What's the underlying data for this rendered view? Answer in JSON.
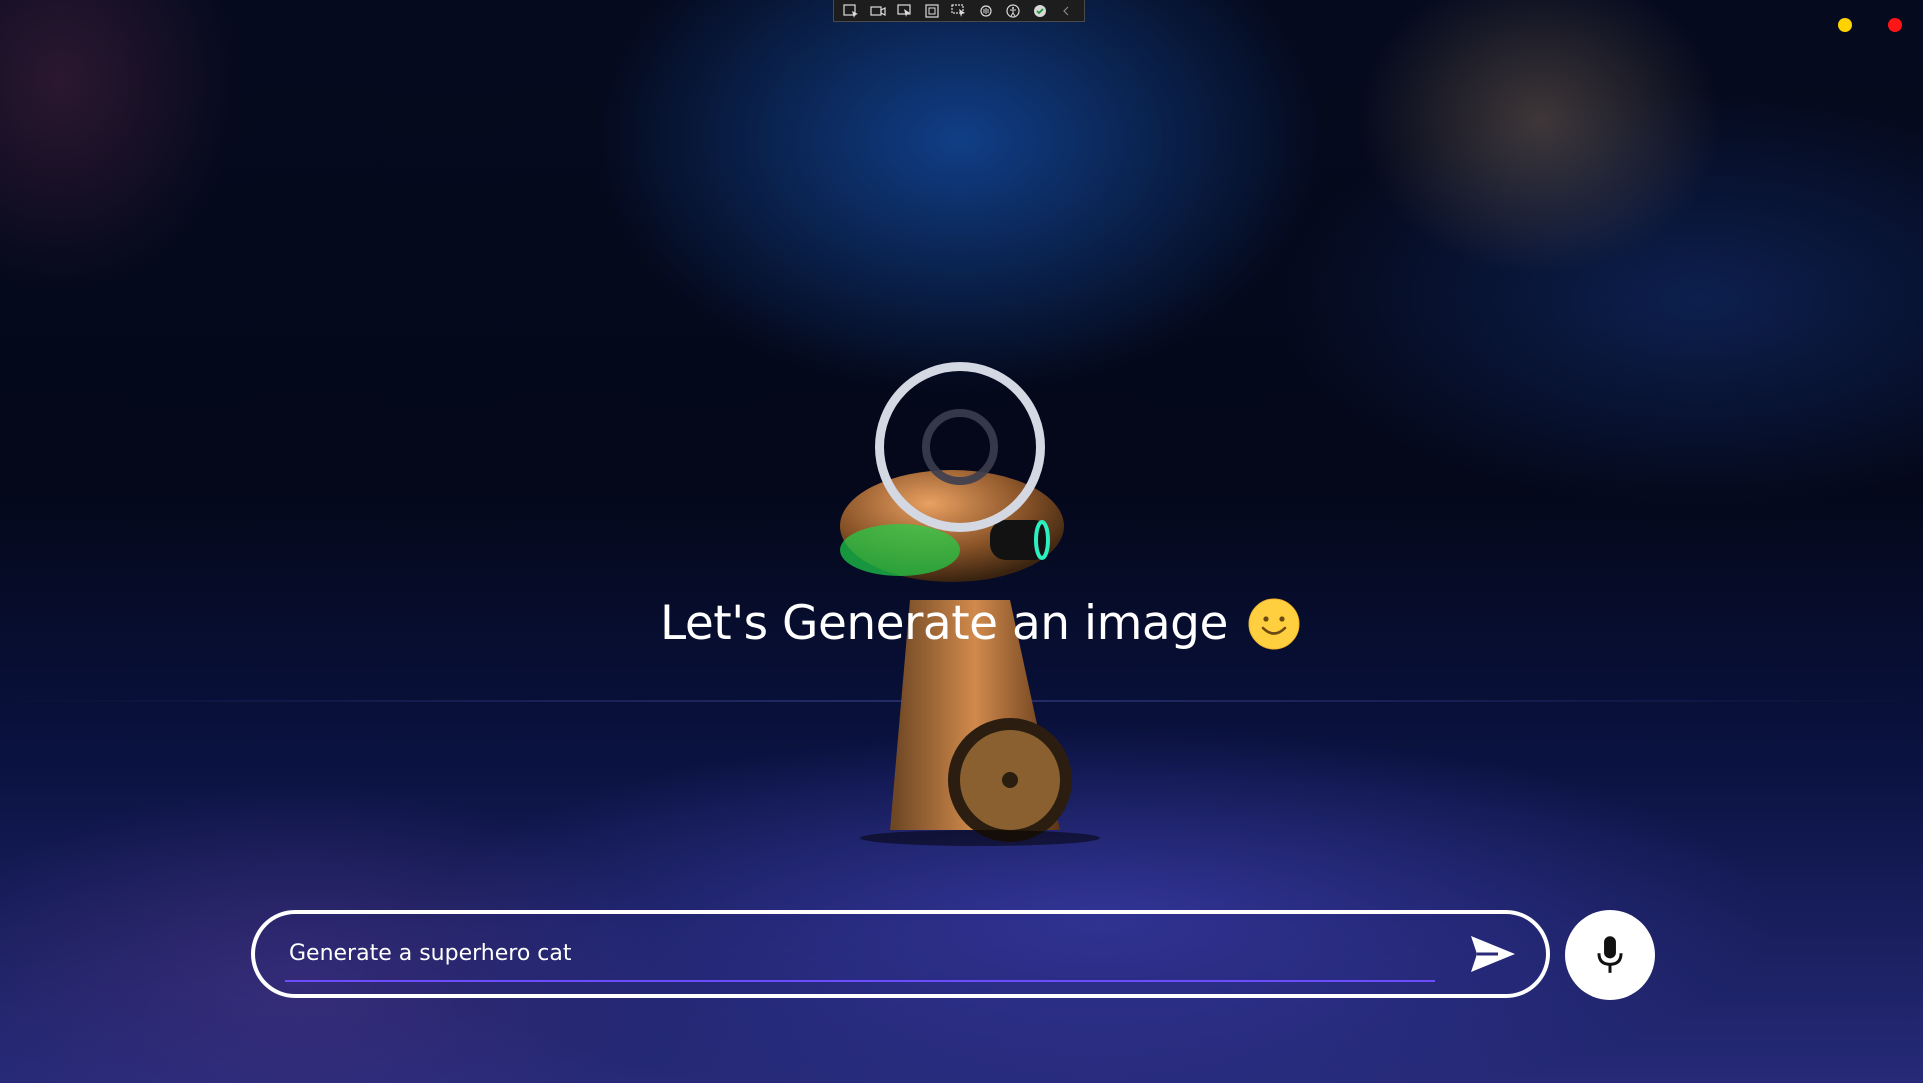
{
  "toolbar": {
    "icons": [
      "select-window-icon",
      "video-icon",
      "pointer-icon",
      "region-icon",
      "cursor-select-icon",
      "audio-icon",
      "accessibility-icon",
      "check-icon",
      "collapse-icon"
    ]
  },
  "window_controls": {
    "minimize_color": "#ffd200",
    "close_color": "#ff1515"
  },
  "main": {
    "headline": "Let's Generate an image",
    "headline_emoji": "smiley-face-icon"
  },
  "prompt": {
    "value": "Generate a superhero cat"
  },
  "actions": {
    "send_icon": "send-icon",
    "mic_icon": "microphone-icon"
  },
  "colors": {
    "accent_underline": "#6b4dff",
    "emoji_yellow": "#ffcf3f"
  }
}
